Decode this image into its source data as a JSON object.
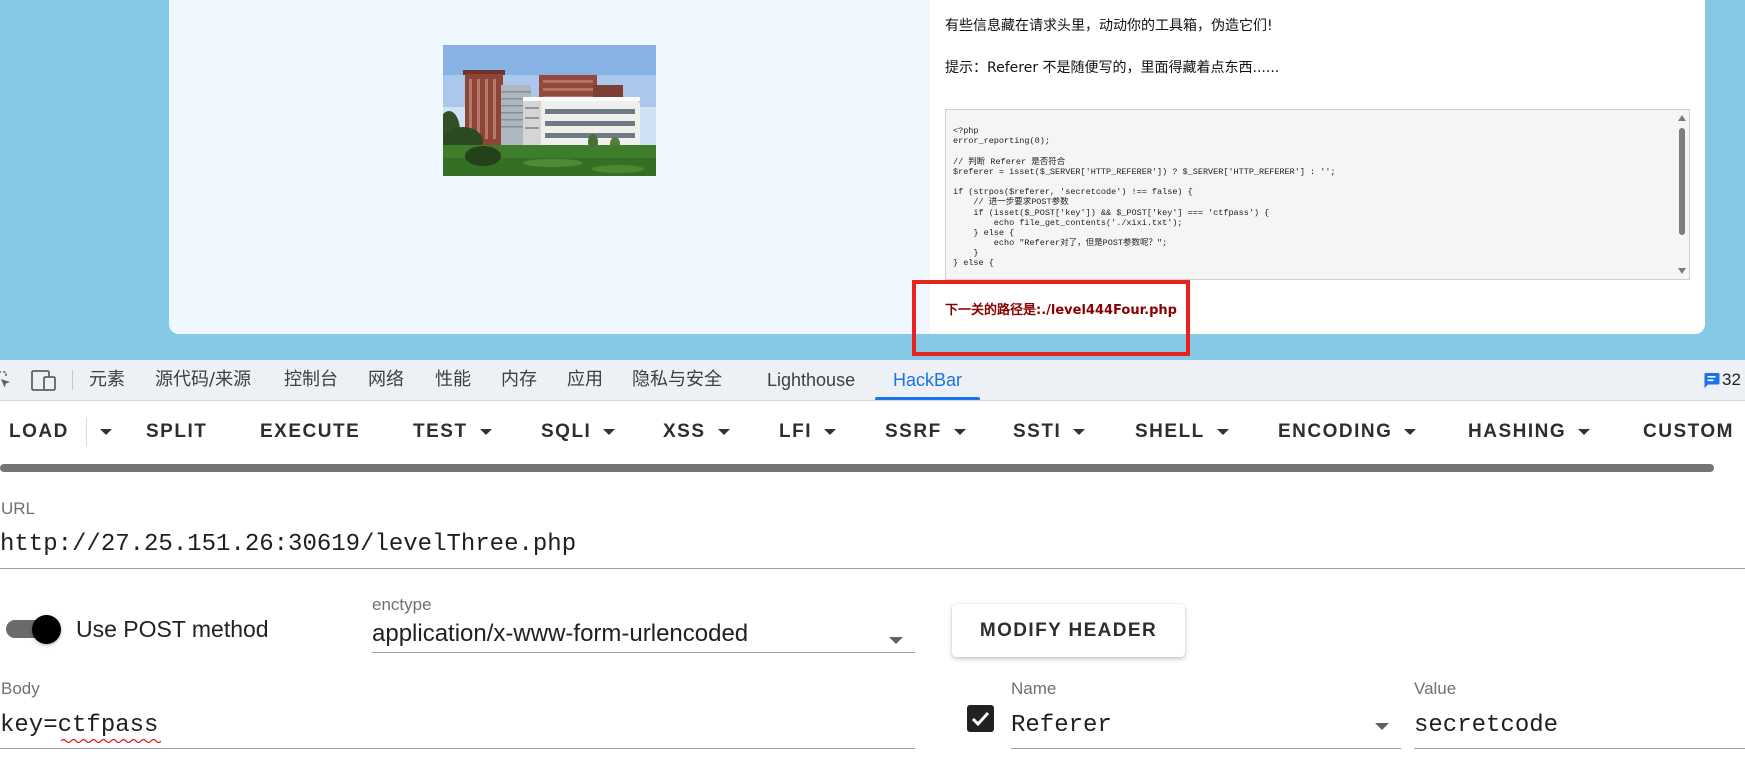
{
  "colors": {
    "page_background": "#86c9e5",
    "accent": "#1a73e8",
    "highlight_frame": "#e8231f",
    "next_level_text": "#8b0000"
  },
  "page": {
    "message": "有些信息藏在请求头里，动动你的工具箱，伪造它们!",
    "hint": "提示：Referer 不是随便写的，里面得藏着点东西......",
    "code_lines": [
      "<?php",
      "error_reporting(0);",
      "",
      "// 判断 Referer 是否符合",
      "$referer = isset($_SERVER['HTTP_REFERER']) ? $_SERVER['HTTP_REFERER'] : '';",
      "",
      "if (strpos($referer, 'secretcode') !== false) {",
      "    // 进一步要求POST参数",
      "    if (isset($_POST['key']) && $_POST['key'] === 'ctfpass') {",
      "        echo file_get_contents('./xixi.txt');",
      "    } else {",
      "        echo \"Referer对了，但是POST参数呢？\";",
      "    }",
      "} else {"
    ],
    "next_level": "下一关的路径是:./level444Four.php"
  },
  "devtools": {
    "icons": [
      "inspect-element-icon",
      "device-toolbar-icon"
    ],
    "tabs": [
      {
        "label": "元素"
      },
      {
        "label": "源代码/来源"
      },
      {
        "label": "控制台"
      },
      {
        "label": "网络"
      },
      {
        "label": "性能"
      },
      {
        "label": "内存"
      },
      {
        "label": "应用"
      },
      {
        "label": "隐私与安全"
      },
      {
        "label": "Lighthouse"
      },
      {
        "label": "HackBar",
        "active": true
      }
    ],
    "issues_icon": "message-icon",
    "issues_count": "32"
  },
  "hackbar": {
    "toolbar": [
      {
        "label": "LOAD",
        "dropdown": true
      },
      {
        "label": "SPLIT",
        "dropdown": false
      },
      {
        "label": "EXECUTE",
        "dropdown": false
      },
      {
        "label": "TEST",
        "dropdown": true
      },
      {
        "label": "SQLI",
        "dropdown": true
      },
      {
        "label": "XSS",
        "dropdown": true
      },
      {
        "label": "LFI",
        "dropdown": true
      },
      {
        "label": "SSRF",
        "dropdown": true
      },
      {
        "label": "SSTI",
        "dropdown": true
      },
      {
        "label": "SHELL",
        "dropdown": true
      },
      {
        "label": "ENCODING",
        "dropdown": true
      },
      {
        "label": "HASHING",
        "dropdown": true
      },
      {
        "label": "CUSTOM",
        "dropdown": false
      }
    ],
    "url_label": "URL",
    "url": "http://27.25.151.26:30619/levelThree.php",
    "use_post_label": "Use POST method",
    "use_post": true,
    "enctype_label": "enctype",
    "enctype": "application/x-www-form-urlencoded",
    "modify_header_label": "MODIFY HEADER",
    "body_label": "Body",
    "body": "key=ctfpass",
    "header_name_label": "Name",
    "header_value_label": "Value",
    "headers": [
      {
        "enabled": true,
        "name": "Referer",
        "value": "secretcode"
      }
    ]
  }
}
